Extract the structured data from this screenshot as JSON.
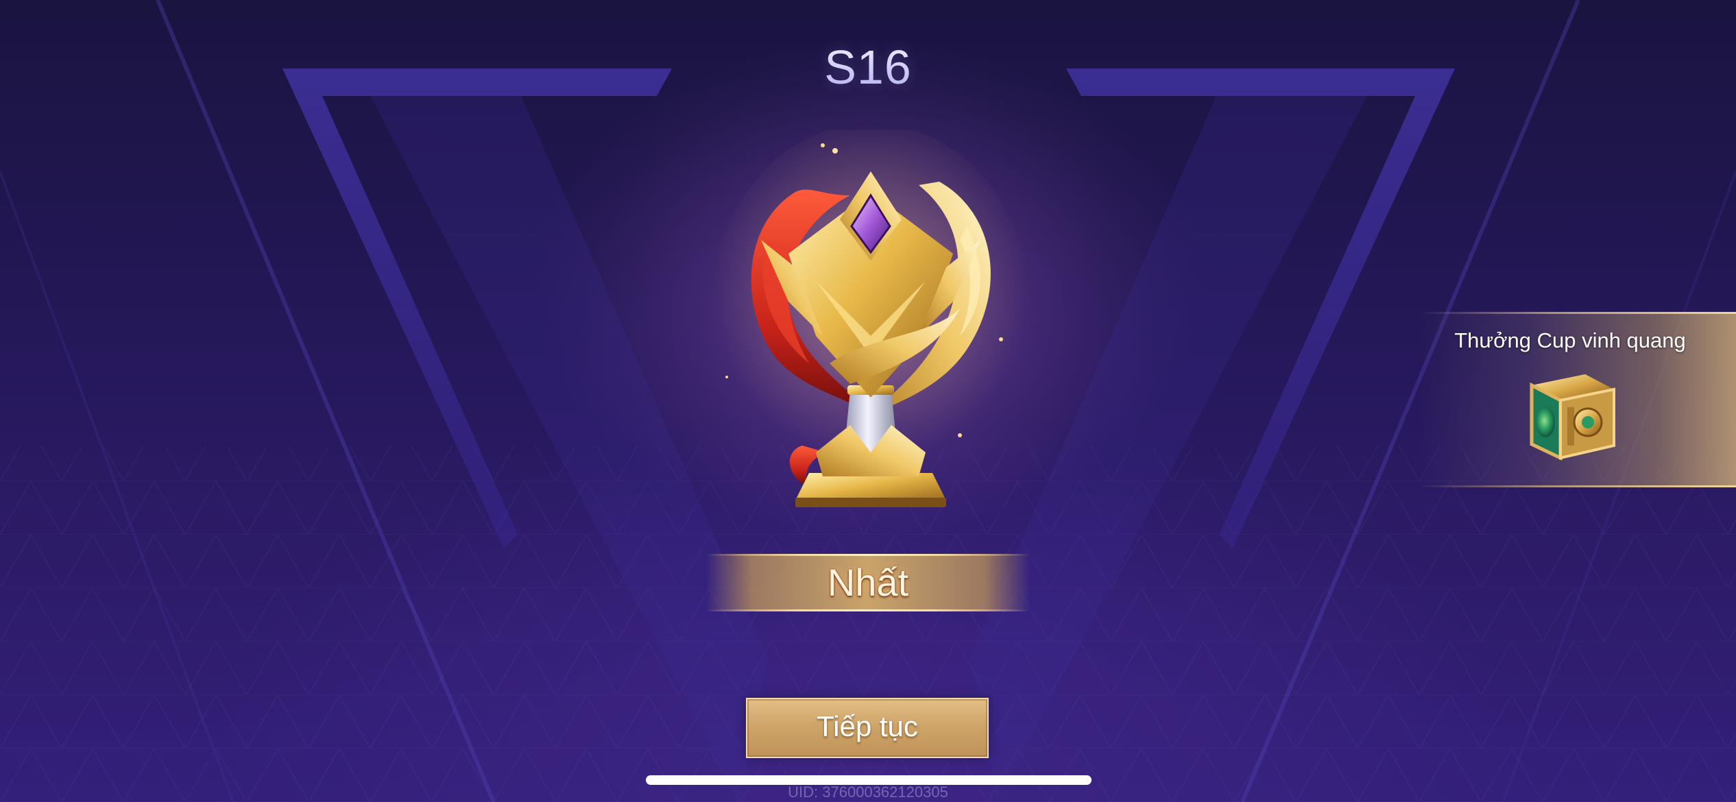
{
  "season": {
    "title": "S16"
  },
  "trophy": {
    "icon": "gold-trophy-icon",
    "gem_color": "#a35ad8",
    "gold_color": "#e8b94a",
    "flame_color": "#c8231a"
  },
  "rank": {
    "label": "Nhất"
  },
  "reward": {
    "title": "Thưởng Cup vinh quang",
    "icon": "treasure-chest-icon"
  },
  "actions": {
    "continue_label": "Tiếp tục"
  },
  "footer": {
    "uid": "UID: 376000362120305"
  },
  "colors": {
    "background": "#2a1a60",
    "accent_gold": "#d4ab6e",
    "title_silver": "#d8d6ff"
  }
}
